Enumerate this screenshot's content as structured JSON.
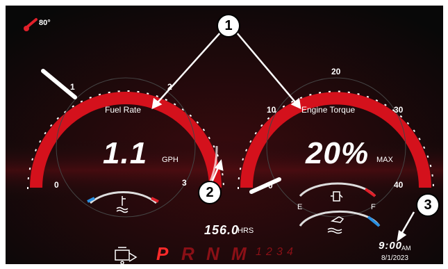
{
  "temperature": {
    "value": "80°",
    "icon": "thermometer-icon",
    "color": "#e0202a"
  },
  "fuel_gauge": {
    "title": "Fuel Rate",
    "value": "1.1",
    "unit": "GPH",
    "ticks": [
      "0",
      "1",
      "2",
      "3"
    ],
    "coolant_icon": "coolant-temperature-icon"
  },
  "torque_gauge": {
    "title": "Engine Torque",
    "value": "20%",
    "unit": "MAX",
    "ticks": [
      "0",
      "10",
      "20",
      "30",
      "40"
    ],
    "fuel_empty_label": "E",
    "fuel_full_label": "F",
    "fuel_icon": "fuel-pump-icon",
    "oil_icon": "oil-level-icon"
  },
  "engine_hours": {
    "value": "156.0",
    "unit": "HRS"
  },
  "gears": {
    "icon": "engine-icon",
    "items": [
      "P",
      "R",
      "N",
      "M"
    ],
    "numbers": [
      "1",
      "2",
      "3",
      "4"
    ]
  },
  "clock": {
    "time": "9:00",
    "ampm": "AM",
    "date": "8/1/2023"
  },
  "callouts": [
    "1",
    "2",
    "3"
  ],
  "colors": {
    "accent_red": "#d4111c",
    "background": "#0a0a0a",
    "blue_indicator": "#2a8fe0"
  }
}
